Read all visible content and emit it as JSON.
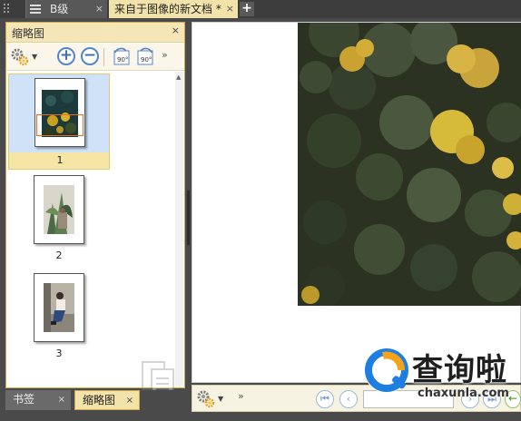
{
  "tabs": [
    {
      "label": "B级",
      "close": "×"
    },
    {
      "label": "来自于图像的新文档 *",
      "close": "×"
    }
  ],
  "tab_add": "+",
  "panel": {
    "title": "缩略图",
    "close": "×",
    "toolbar": {
      "settings_icon": "gear-icon",
      "zoom_in": "+",
      "zoom_out": "−",
      "rotate_left_label": "90°",
      "rotate_right_label": "90°",
      "more": "»"
    },
    "thumbnails": [
      {
        "number": "1",
        "selected": true
      },
      {
        "number": "2",
        "selected": false
      },
      {
        "number": "3",
        "selected": false
      }
    ]
  },
  "bottom_tabs": [
    {
      "label": "书签",
      "close": "×"
    },
    {
      "label": "缩略图",
      "close": "×"
    }
  ],
  "statusbar": {
    "more": "»",
    "first": "⏮",
    "prev": "‹",
    "next": "›",
    "last": "⏭",
    "back": "←"
  },
  "logo": {
    "name": "查询啦",
    "domain": "chaxunla.com"
  },
  "colors": {
    "accent": "#f2e3ab",
    "selection": "#cfe2f8",
    "logo_blue": "#1e7fe0"
  }
}
